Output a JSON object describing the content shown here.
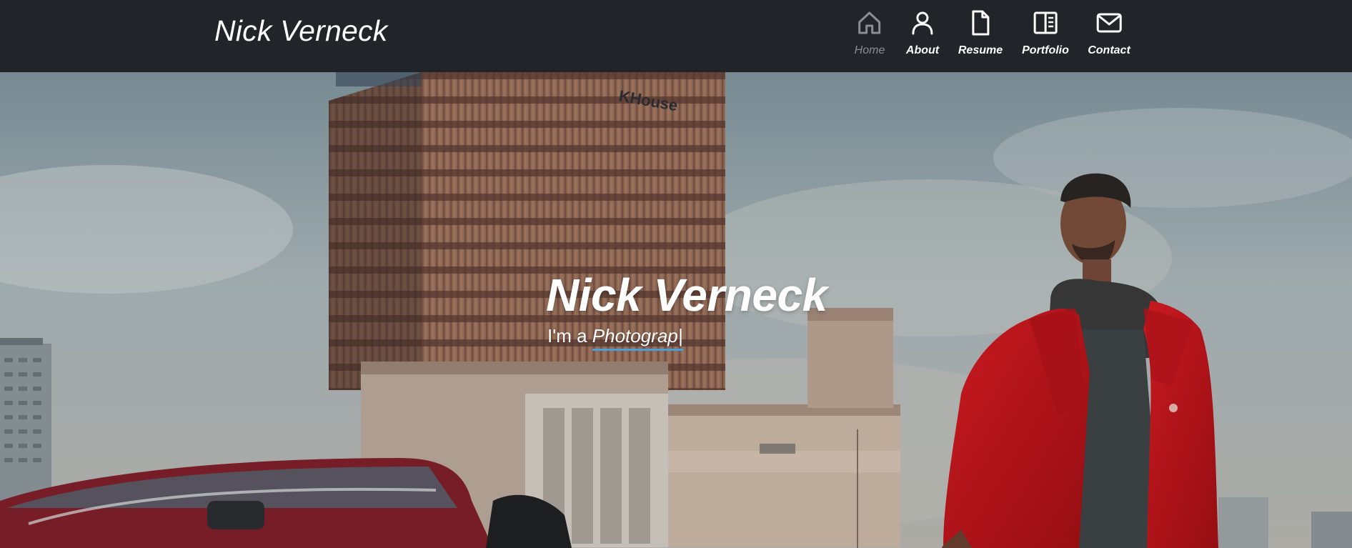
{
  "navbar": {
    "brand": "Nick Verneck",
    "items": [
      {
        "label": "Home",
        "icon": "home-icon",
        "active": true
      },
      {
        "label": "About",
        "icon": "user-icon",
        "active": false
      },
      {
        "label": "Resume",
        "icon": "file-icon",
        "active": false
      },
      {
        "label": "Portfolio",
        "icon": "book-icon",
        "active": false
      },
      {
        "label": "Contact",
        "icon": "envelope-icon",
        "active": false
      }
    ]
  },
  "hero": {
    "title": "Nick Verneck",
    "subtitle_prefix": "I'm a ",
    "typed_text": "Photograp|"
  },
  "colors": {
    "navbar_bg": "#212428",
    "active_nav": "#8a8d91",
    "typed_underline": "#4a9fd8",
    "coat": "#c8161d"
  }
}
